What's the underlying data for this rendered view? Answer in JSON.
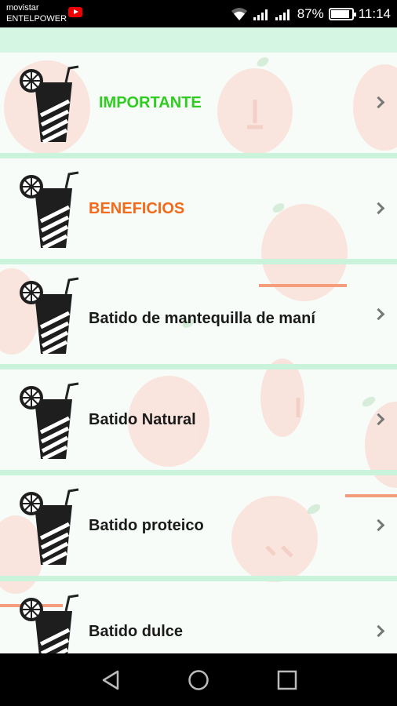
{
  "status_bar": {
    "carrier_line1": "movistar",
    "carrier_line2": "ENTELPOWER",
    "battery": "87%",
    "time": "11:14",
    "icons": [
      "youtube-icon",
      "wifi-icon",
      "signal-icon",
      "signal-icon",
      "battery-icon"
    ]
  },
  "list": {
    "items": [
      {
        "label": "IMPORTANTE",
        "color": "#2ecc1f",
        "bold": true
      },
      {
        "label": "BENEFICIOS",
        "color": "#f26a1b",
        "bold": true
      },
      {
        "label": "Batido de mantequilla de maní",
        "color": "#1a1a1a",
        "bold": true
      },
      {
        "label": "Batido Natural",
        "color": "#1a1a1a",
        "bold": true
      },
      {
        "label": "Batido proteico",
        "color": "#1a1a1a",
        "bold": true
      },
      {
        "label": "Batido dulce",
        "color": "#1a1a1a",
        "bold": true
      }
    ]
  },
  "nav_bar": {
    "buttons": [
      "back-icon",
      "home-icon",
      "recents-icon"
    ]
  },
  "colors": {
    "divider": "#c9f3da",
    "background": "#f4fbf7",
    "apple": "#f6a08f"
  }
}
